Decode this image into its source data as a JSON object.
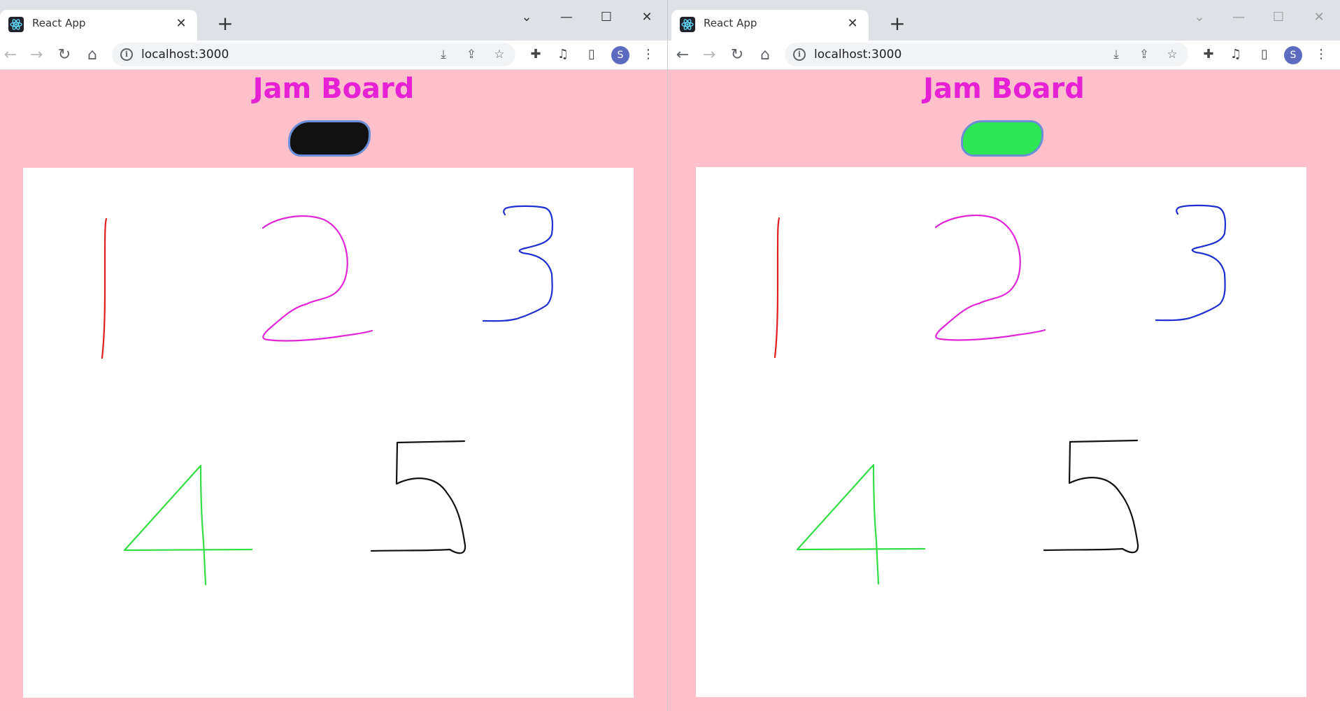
{
  "left_window": {
    "tab": {
      "title": "React App"
    },
    "address": {
      "url": "localhost:3000"
    },
    "profile_initial": "S",
    "page": {
      "title": "Jam Board",
      "color_button_fill": "#111111"
    }
  },
  "right_window": {
    "tab": {
      "title": "React App"
    },
    "address": {
      "url": "localhost:3000"
    },
    "profile_initial": "S",
    "page": {
      "title": "Jam Board",
      "color_button_fill": "#2ee553"
    }
  },
  "drawing": {
    "strokes": [
      {
        "name": "stroke-digit-1",
        "color": "#e01f1f"
      },
      {
        "name": "stroke-digit-2",
        "color": "#e026d8"
      },
      {
        "name": "stroke-digit-3",
        "color": "#1f2fd0"
      },
      {
        "name": "stroke-digit-4",
        "color": "#33dd44"
      },
      {
        "name": "stroke-digit-5",
        "color": "#111111"
      }
    ]
  },
  "colors": {
    "page_background": "#ffc0cb",
    "title": "#e620d4",
    "button_border": "#6b8fd6"
  },
  "icons": {
    "tab_favicon": "react-icon",
    "close": "close-icon",
    "new_tab": "plus-icon",
    "back": "back-arrow-icon",
    "forward": "forward-arrow-icon",
    "reload": "reload-icon",
    "home": "home-icon",
    "site_info": "info-icon",
    "install": "install-icon",
    "share": "share-icon",
    "bookmark": "star-icon",
    "extensions": "puzzle-icon",
    "media": "media-list-icon",
    "side_panel": "side-panel-icon",
    "menu": "kebab-menu-icon"
  }
}
